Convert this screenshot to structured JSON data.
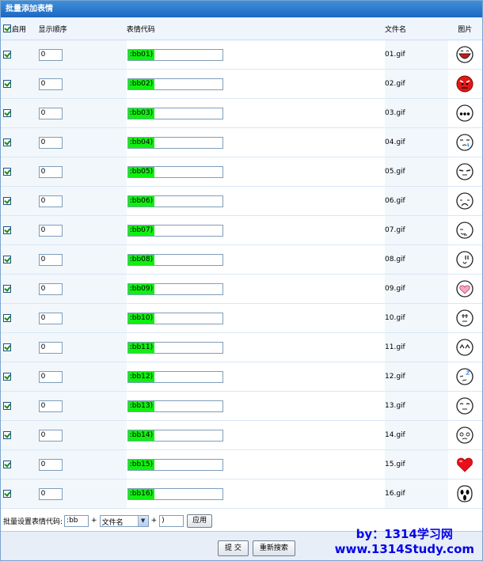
{
  "title": "批量添加表情",
  "columns": {
    "enable": "启用",
    "order": "显示顺序",
    "code": "表情代码",
    "filename": "文件名",
    "image": "图片"
  },
  "rows": [
    {
      "order": "0",
      "code": ":bb01)",
      "file": "01.gif",
      "face": "open-mouth-face-icon"
    },
    {
      "order": "0",
      "code": ":bb02)",
      "file": "02.gif",
      "face": "angry-red-face-icon"
    },
    {
      "order": "0",
      "code": ":bb03)",
      "file": "03.gif",
      "face": "dots-face-icon"
    },
    {
      "order": "0",
      "code": ":bb04)",
      "file": "04.gif",
      "face": "crying-face-icon"
    },
    {
      "order": "0",
      "code": ":bb05)",
      "file": "05.gif",
      "face": "squint-face-icon"
    },
    {
      "order": "0",
      "code": ":bb06)",
      "file": "06.gif",
      "face": "sad-face-icon"
    },
    {
      "order": "0",
      "code": ":bb07)",
      "file": "07.gif",
      "face": "side-smirk-face-icon"
    },
    {
      "order": "0",
      "code": ":bb08)",
      "file": "08.gif",
      "face": "shocked-face-icon"
    },
    {
      "order": "0",
      "code": ":bb09)",
      "file": "09.gif",
      "face": "heart-face-icon"
    },
    {
      "order": "0",
      "code": ":bb10)",
      "file": "10.gif",
      "face": "annoyed-face-icon"
    },
    {
      "order": "0",
      "code": ":bb11)",
      "file": "11.gif",
      "face": "happy-face-icon"
    },
    {
      "order": "0",
      "code": ":bb12)",
      "file": "12.gif",
      "face": "sleepy-face-icon"
    },
    {
      "order": "0",
      "code": ":bb13)",
      "file": "13.gif",
      "face": "content-face-icon"
    },
    {
      "order": "0",
      "code": ":bb14)",
      "file": "14.gif",
      "face": "dizzy-face-icon"
    },
    {
      "order": "0",
      "code": ":bb15)",
      "file": "15.gif",
      "face": "red-heart-icon"
    },
    {
      "order": "0",
      "code": ":bb16)",
      "file": "16.gif",
      "face": "scream-face-icon"
    }
  ],
  "bulk": {
    "label": "批量设置表情代码:",
    "prefix": ":bb",
    "plus1": "+",
    "select": "文件名",
    "plus2": "+",
    "suffix": ")",
    "apply": "应用"
  },
  "footer": {
    "submit": "提 交",
    "reset": "重新搜索"
  },
  "watermark": {
    "line1": "by：1314学习网",
    "line2": "www.1314Study.com"
  },
  "colors": {
    "title_bar": "#1d67c2",
    "code_highlight": "#10f010",
    "watermark": "#0404e8"
  }
}
